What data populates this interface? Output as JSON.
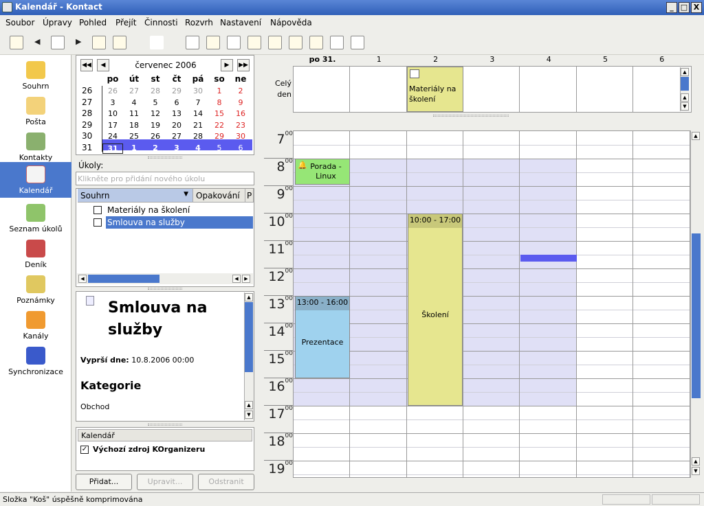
{
  "window": {
    "title": "Kalendář - Kontact",
    "min": "_",
    "max": "□",
    "close": "X"
  },
  "menu": [
    "Soubor",
    "Úpravy",
    "Pohled",
    "Přejít",
    "Činnosti",
    "Rozvrh",
    "Nastavení",
    "Nápověda"
  ],
  "sidebar": [
    {
      "label": "Souhrn",
      "icon": "summary-icon",
      "color": "#f2c84b"
    },
    {
      "label": "Pošta",
      "icon": "mail-icon",
      "color": "#f3d27a"
    },
    {
      "label": "Kontakty",
      "icon": "contacts-icon",
      "color": "#8ab06e"
    },
    {
      "label": "Kalendář",
      "icon": "calendar-icon",
      "color": "#f4f4f4"
    },
    {
      "label": "Seznam úkolů",
      "icon": "todo-icon",
      "color": "#8fc46a"
    },
    {
      "label": "Deník",
      "icon": "journal-icon",
      "color": "#c94a4a"
    },
    {
      "label": "Poznámky",
      "icon": "notes-icon",
      "color": "#e0c860"
    },
    {
      "label": "Kanály",
      "icon": "feeds-icon",
      "color": "#f09a30"
    },
    {
      "label": "Synchronizace",
      "icon": "sync-icon",
      "color": "#3a5acb"
    }
  ],
  "minical": {
    "month": "červenec 2006",
    "days": [
      "po",
      "út",
      "st",
      "čt",
      "pá",
      "so",
      "ne"
    ],
    "weeks": [
      {
        "wk": "26",
        "d": [
          "26",
          "27",
          "28",
          "29",
          "30",
          "1",
          "2"
        ]
      },
      {
        "wk": "27",
        "d": [
          "3",
          "4",
          "5",
          "6",
          "7",
          "8",
          "9"
        ]
      },
      {
        "wk": "28",
        "d": [
          "10",
          "11",
          "12",
          "13",
          "14",
          "15",
          "16"
        ]
      },
      {
        "wk": "29",
        "d": [
          "17",
          "18",
          "19",
          "20",
          "21",
          "22",
          "23"
        ]
      },
      {
        "wk": "30",
        "d": [
          "24",
          "25",
          "26",
          "27",
          "28",
          "29",
          "30"
        ]
      },
      {
        "wk": "31",
        "d": [
          "31",
          "1",
          "2",
          "3",
          "4",
          "5",
          "6"
        ]
      }
    ]
  },
  "tasks": {
    "label": "Úkoly:",
    "placeholder": "Klikněte pro přidání nového úkolu",
    "cols": [
      "Souhrn",
      "Opakování",
      "P"
    ],
    "items": [
      "Materiály na školení",
      "Smlouva na služby"
    ]
  },
  "detail": {
    "title": "Smlouva na služby",
    "due_label": "Vyprší dne:",
    "due_value": "10.8.2006 00:00",
    "cat_label": "Kategorie",
    "cat_value": "Obchod"
  },
  "resources": {
    "header": "Kalendář",
    "item": "Výchozí zdroj KOrganizeru"
  },
  "buttons": {
    "add": "Přidat...",
    "edit": "Upravit...",
    "remove": "Odstranit"
  },
  "agenda": {
    "allday": "Celý den",
    "days": [
      "po 31.",
      "1",
      "2",
      "3",
      "4",
      "5",
      "6"
    ],
    "hours": [
      "7",
      "8",
      "9",
      "10",
      "11",
      "12",
      "13",
      "14",
      "15",
      "16",
      "17",
      "18",
      "19"
    ],
    "events": [
      {
        "title": "Materiály na školení"
      },
      {
        "title": "Porada - Linux"
      },
      {
        "time": "10:00 - 17:00",
        "title": "Školení"
      },
      {
        "time": "13:00 - 16:00",
        "title": "Prezentace"
      }
    ]
  },
  "status": "Složka \"Koš\" úspěšně komprimována"
}
